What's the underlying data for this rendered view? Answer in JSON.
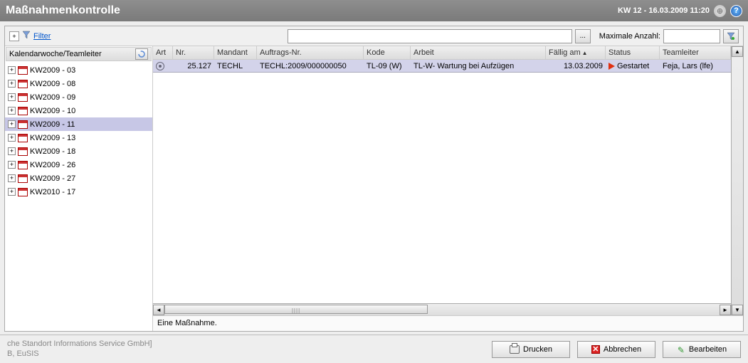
{
  "header": {
    "title": "Maßnahmenkontrolle",
    "right_text": "KW 12 - 16.03.2009 11:20"
  },
  "filter": {
    "link_label": "Filter",
    "max_label": "Maximale Anzahl:",
    "ellipsis": "..."
  },
  "tree": {
    "header_label": "Kalendarwoche/Teamleiter",
    "items": [
      {
        "label": "KW2009 - 03",
        "selected": false
      },
      {
        "label": "KW2009 - 08",
        "selected": false
      },
      {
        "label": "KW2009 - 09",
        "selected": false
      },
      {
        "label": "KW2009 - 10",
        "selected": false
      },
      {
        "label": "KW2009 - 11",
        "selected": true
      },
      {
        "label": "KW2009 - 13",
        "selected": false
      },
      {
        "label": "KW2009 - 18",
        "selected": false
      },
      {
        "label": "KW2009 - 26",
        "selected": false
      },
      {
        "label": "KW2009 - 27",
        "selected": false
      },
      {
        "label": "KW2010 - 17",
        "selected": false
      }
    ]
  },
  "grid": {
    "columns": {
      "art": "Art",
      "nr": "Nr.",
      "mandant": "Mandant",
      "auftrag": "Auftrags-Nr.",
      "kode": "Kode",
      "arbeit": "Arbeit",
      "faellig": "Fällig am",
      "status": "Status",
      "teamleiter": "Teamleiter"
    },
    "rows": [
      {
        "nr": "25.127",
        "mandant": "TECHL",
        "auftrag": "TECHL:2009/000000050",
        "kode": "TL-09 (W)",
        "arbeit": "TL-W- Wartung bei Aufzügen",
        "faellig": "13.03.2009",
        "status": "Gestartet",
        "teamleiter": "Feja, Lars (lfe)"
      }
    ]
  },
  "status_bar": "Eine Maßnahme.",
  "footer": {
    "line1": "che Standort Informations Service GmbH]",
    "line2": "B, EuSIS",
    "btn_print": "Drucken",
    "btn_cancel": "Abbrechen",
    "btn_edit": "Bearbeiten"
  }
}
